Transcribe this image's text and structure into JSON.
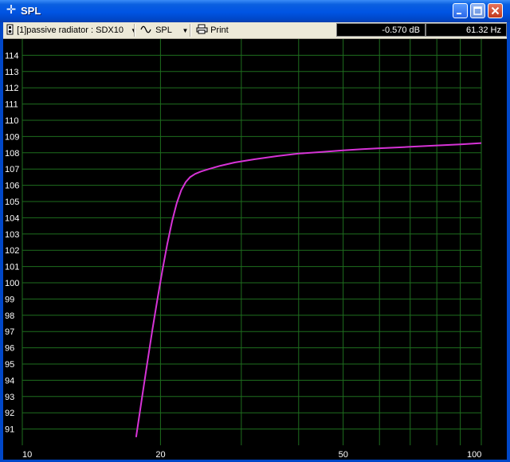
{
  "window": {
    "title": "SPL",
    "icon": "crosshair-icon"
  },
  "toolbar": {
    "project_selector": "[1]passive radiator : SDX10",
    "view_selector": "SPL",
    "print_label": "Print",
    "readout_db": "-0.570 dB",
    "readout_hz": "61.32 Hz"
  },
  "chart_data": {
    "type": "line",
    "title": "",
    "xlabel": "",
    "ylabel": "",
    "x_scale": "log",
    "xlim": [
      10,
      100
    ],
    "ylim": [
      90,
      115
    ],
    "grid": true,
    "x_ticks": [
      10,
      20,
      50,
      100
    ],
    "y_ticks": [
      91,
      92,
      93,
      94,
      95,
      96,
      97,
      98,
      99,
      100,
      101,
      102,
      103,
      104,
      105,
      106,
      107,
      108,
      109,
      110,
      111,
      112,
      113,
      114
    ],
    "colors": {
      "background": "#000000",
      "grid": "#1e6e1e",
      "curve": "#d633d6",
      "tick_text": "#ffffff"
    },
    "series": [
      {
        "x": [
          17.7,
          18.2,
          18.7,
          19.2,
          19.7,
          20.2,
          20.7,
          21.2,
          21.7,
          22.2,
          22.7,
          23.2,
          23.8,
          24.5,
          25.5,
          27,
          29,
          32,
          36,
          40,
          45,
          50,
          55,
          60,
          70,
          80,
          90,
          100
        ],
        "y": [
          90.5,
          92.8,
          95.0,
          97.1,
          99.0,
          100.8,
          102.4,
          103.8,
          104.9,
          105.7,
          106.2,
          106.5,
          106.7,
          106.85,
          107.0,
          107.2,
          107.4,
          107.6,
          107.8,
          107.95,
          108.05,
          108.15,
          108.22,
          108.28,
          108.37,
          108.45,
          108.52,
          108.6
        ]
      }
    ]
  }
}
